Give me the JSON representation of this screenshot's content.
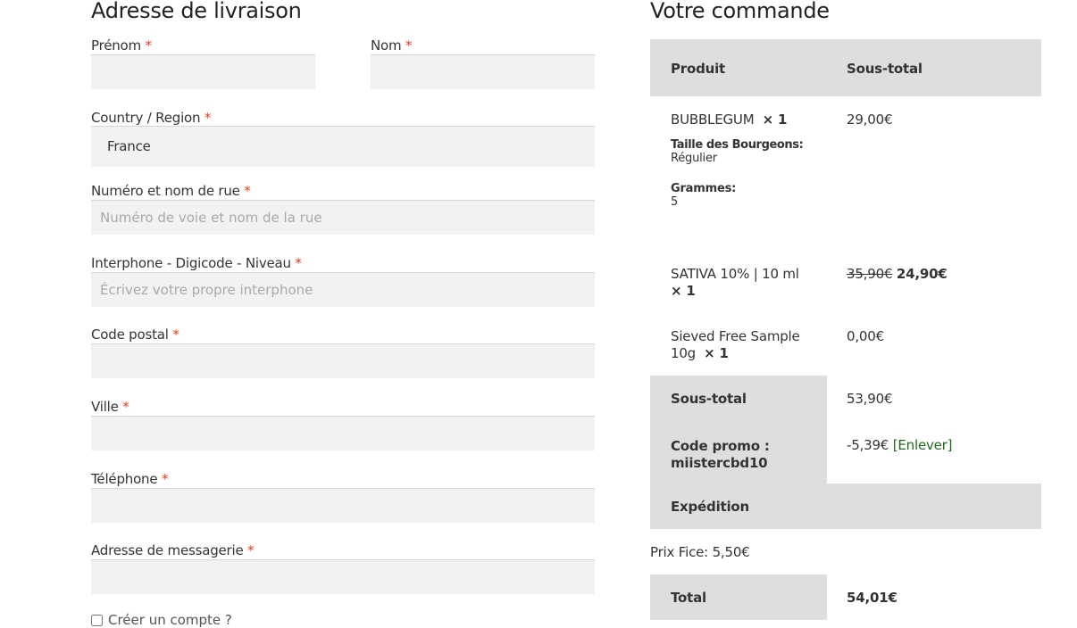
{
  "shipping": {
    "title": "Adresse de livraison",
    "required_mark": "*",
    "first_name_label": "Prénom",
    "last_name_label": "Nom",
    "country_label": "Country / Region",
    "country_value": "France",
    "street_label": "Numéro et nom de rue",
    "street_placeholder": "Numéro de voie et nom de la rue",
    "intercom_label": "Interphone - Digicode - Niveau",
    "intercom_placeholder": "Écrivez votre propre interphone",
    "postcode_label": "Code postal",
    "city_label": "Ville",
    "phone_label": "Téléphone",
    "email_label": "Adresse de messagerie",
    "create_account_label": "Créer un compte ?"
  },
  "order": {
    "title": "Votre commande",
    "header_product": "Produit",
    "header_subtotal": "Sous-total",
    "items": [
      {
        "name": "BUBBLEGUM",
        "qty": "× 1",
        "meta": [
          {
            "key": "Taille des Bourgeons:",
            "value": "Régulier"
          },
          {
            "key": "Grammes:",
            "value": "5"
          }
        ],
        "price": "29,00€"
      },
      {
        "name_line1": "SATIVA 10% | 10 ml",
        "qty": "× 1",
        "old_price": "35,90€",
        "price": "24,90€"
      },
      {
        "name_line1": "Sieved Free Sample",
        "name_line2": "10g",
        "qty": "× 1",
        "price": "0,00€"
      }
    ],
    "subtotal_label": "Sous-total",
    "subtotal_value": "53,90€",
    "coupon_label_line1": "Code promo :",
    "coupon_label_line2": "miistercbd10",
    "coupon_value": "-5,39€",
    "coupon_remove": "[Enlever]",
    "shipping_label": "Expédition",
    "shipping_note": "Prix Fice: 5,50€",
    "total_label": "Total",
    "total_value": "54,01€"
  },
  "colors": {
    "required": "#e2401c",
    "field_bg": "#f2f2f2",
    "table_header_bg": "#dedede",
    "link": "#1e6b1e"
  }
}
